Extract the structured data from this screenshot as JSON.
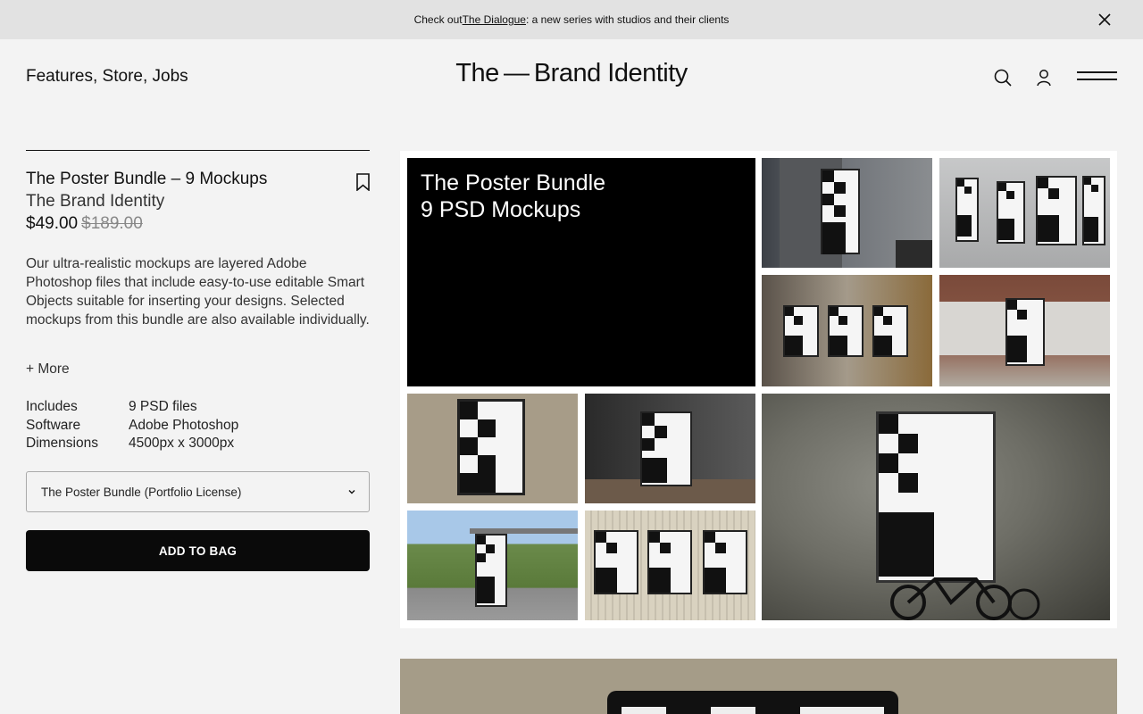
{
  "announcement": {
    "prefix": "Check out ",
    "link": "The Dialogue",
    "suffix": ": a new series with studios and their clients"
  },
  "header": {
    "nav": [
      "Features",
      "Store",
      "Jobs"
    ],
    "logo": "The — Brand Identity",
    "icons": [
      "search-icon",
      "user-icon",
      "menu-icon"
    ]
  },
  "product": {
    "title": "The Poster Bundle – 9 Mockups",
    "brand": "The Brand Identity",
    "price": "$49.00",
    "old_price": "$189.00",
    "description": "Our ultra-realistic mockups are layered Adobe Photoshop files that include easy-to-use editable Smart Objects suitable for inserting your designs. Selected mockups from this bundle are also available individually.",
    "more": "+ More",
    "specs": [
      {
        "key": "Includes",
        "value": "9 PSD files"
      },
      {
        "key": "Software",
        "value": "Adobe Photoshop"
      },
      {
        "key": "Dimensions",
        "value": "4500px x 3000px"
      }
    ],
    "license_selected": "The Poster Bundle (Portfolio License)",
    "add_to_bag": "ADD TO BAG"
  },
  "gallery": {
    "hero_line1": "The Poster Bundle",
    "hero_line2": "9 PSD Mockups"
  },
  "colors": {
    "background": "#f3f3f3",
    "announcement_bg": "#e2e2e2",
    "button_bg": "#0a0a0a"
  }
}
